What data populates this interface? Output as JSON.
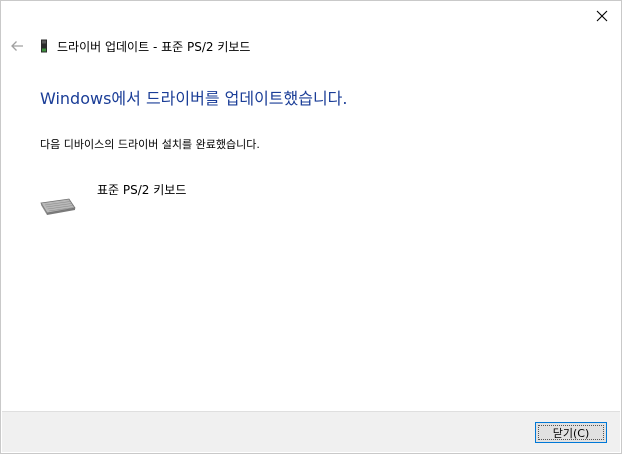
{
  "window": {
    "close_icon": "close-icon"
  },
  "nav": {
    "back_icon": "back-arrow-icon",
    "device_icon": "device-icon",
    "title": "드라이버 업데이트 - 표준 PS/2 키보드"
  },
  "main": {
    "headline": "Windows에서 드라이버를 업데이트했습니다.",
    "message": "다음 디바이스의 드라이버 설치를 완료했습니다.",
    "device": {
      "icon": "keyboard-icon",
      "name": "표준 PS/2 키보드"
    }
  },
  "footer": {
    "close_button_label": "닫기(C)"
  },
  "colors": {
    "headline": "#1a3d97",
    "footer_bg": "#f0f0f0",
    "button_border": "#0078d7"
  }
}
